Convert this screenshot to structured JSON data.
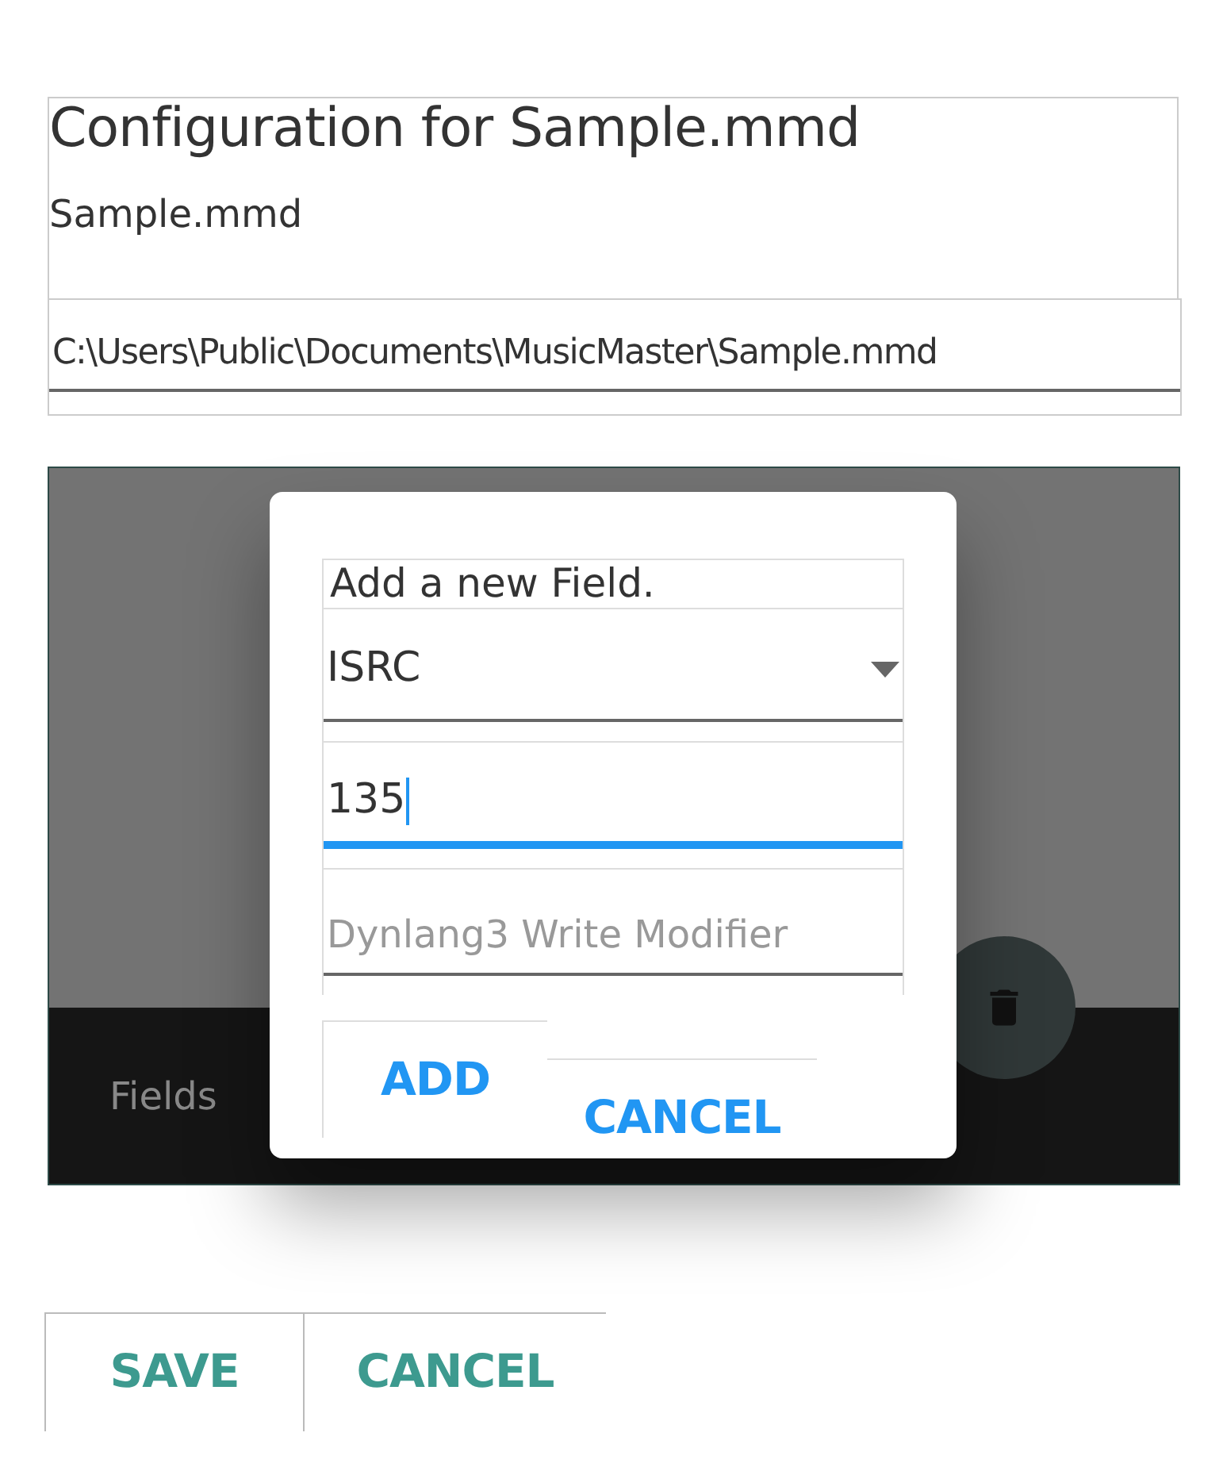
{
  "header": {
    "title": "Configuration for Sample.mmd",
    "file_name": "Sample.mmd"
  },
  "path_field": {
    "value": "C:\\Users\\Public\\Documents\\MusicMaster\\Sample.mmd"
  },
  "panel": {
    "bottom_bar_label": "Fields"
  },
  "dialog": {
    "prompt": "Add a new Field.",
    "inputs": [
      {
        "kind": "dropdown",
        "value": "ISRC",
        "focused": false
      },
      {
        "kind": "text",
        "value": "135",
        "focused": true
      },
      {
        "kind": "text",
        "placeholder": "Dynlang3 Write Modifier",
        "focused": false
      }
    ],
    "buttons": [
      "ADD",
      "CANCEL"
    ]
  },
  "footer_buttons": [
    "SAVE",
    "CANCEL"
  ]
}
